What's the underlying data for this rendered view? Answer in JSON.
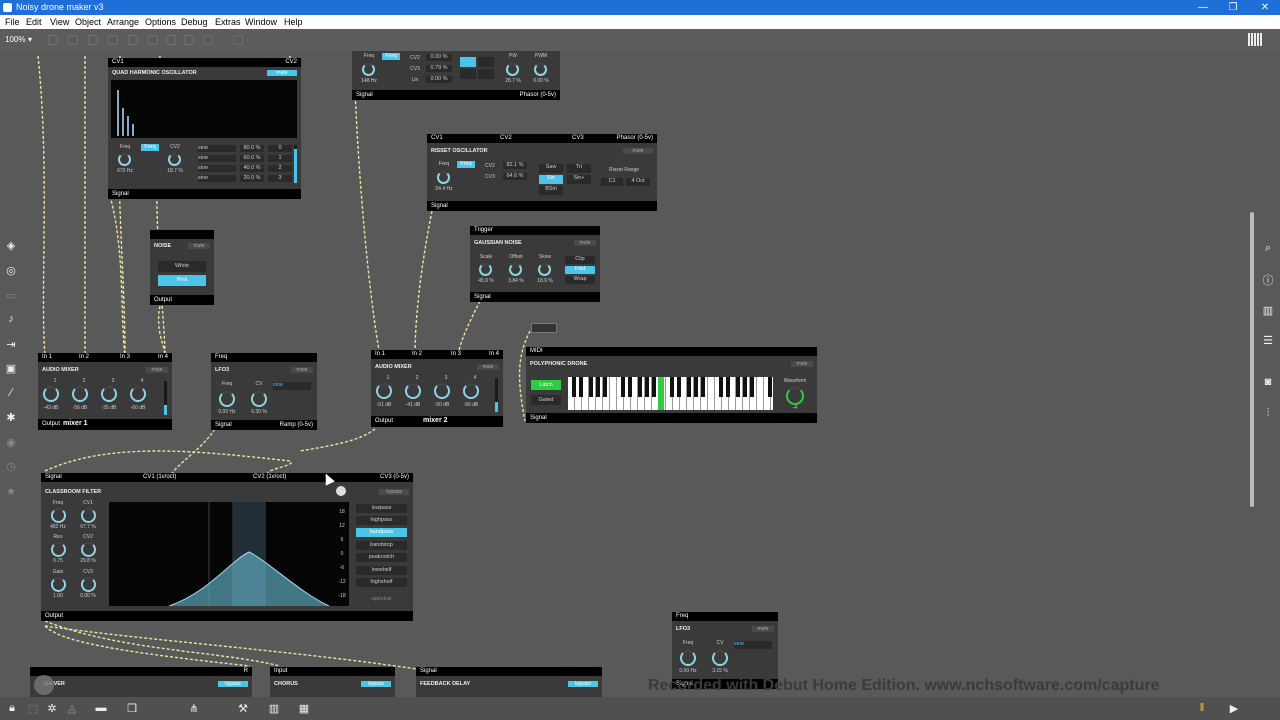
{
  "window": {
    "title": "Noisy drone maker v3",
    "min": "—",
    "max": "❐",
    "close": "✕"
  },
  "menu": [
    "File",
    "Edit",
    "View",
    "Object",
    "Arrange",
    "Options",
    "Debug",
    "Extras",
    "Window",
    "Help"
  ],
  "toolbar": {
    "zoom": "100%"
  },
  "modules": {
    "qho": {
      "cv1": "CV1",
      "cv2": "CV2",
      "title": "QUAD HARMONIC OSCILLATOR",
      "mute": "mute",
      "freq_label": "Freq",
      "freq_btn": "Freq",
      "cv2_label": "CV2",
      "freq_val": "670 Hz",
      "cv2_val": "18.7 %",
      "rows": [
        {
          "wave": "sine",
          "pct": "80.0 %",
          "n": "0"
        },
        {
          "wave": "sine",
          "pct": "60.0 %",
          "n": "1"
        },
        {
          "wave": "sine",
          "pct": "40.0 %",
          "n": "2"
        },
        {
          "wave": "sine",
          "pct": "20.0 %",
          "n": "3"
        }
      ],
      "out": "Signal"
    },
    "top": {
      "freq_label": "Freq",
      "freq_btn": "Freq",
      "freq_val": "148 Hz",
      "cv2": "CV2",
      "cv3": "CV3",
      "lin": "Lin",
      "cv2_v": "0.00 %",
      "cv3_v": "0.79 %",
      "lin_v": "0.00 %",
      "pw": "PW",
      "pwm": "PWM",
      "pw_v": "28.7 %",
      "pwm_v": "0.00 %",
      "out": "Signal",
      "out2": "Phasor (0-5v)"
    },
    "risset": {
      "cv1": "CV1",
      "cv2": "CV2",
      "cv3": "CV3",
      "phasor": "Phasor (0-5v)",
      "title": "RISSET OSCILLATOR",
      "mute": "mute",
      "freq_label": "Freq",
      "freq_btn": "Freq",
      "cv2_label": "CV2",
      "cv2_v": "82.1 %",
      "cv3_label": "CV3",
      "cv3_v": "64.6 %",
      "freq_val": "54.4 Hz",
      "waves": [
        "Saw",
        "Tri",
        "Sin",
        "Sin+",
        "BSin"
      ],
      "range_label": "Risset Range",
      "range_a": "C1",
      "range_b": "4 Oct",
      "out": "Signal"
    },
    "noise": {
      "title": "NOISE",
      "mute": "mute",
      "white": "White",
      "pink": "Pink",
      "out": "Output"
    },
    "gauss": {
      "trigger": "Trigger",
      "title": "GAUSSIAN NOISE",
      "mute": "mute",
      "scale": "Scale",
      "offset": "Offset",
      "skew": "Skew",
      "scale_v": "45.9 %",
      "offset_v": "3.84 %",
      "skew_v": "18.9 %",
      "clip": "Clip",
      "fold": "Fold",
      "wrap": "Wrap",
      "out": "Signal"
    },
    "midiin": "midiin",
    "mixer1": {
      "in": [
        "In 1",
        "In 2",
        "In 3",
        "In 4"
      ],
      "title": "AUDIO MIXER",
      "mute": "mute",
      "nums": [
        "1",
        "2",
        "3",
        "4"
      ],
      "m": "m",
      "vals": [
        "-43 dB",
        "-56 dB",
        "-35 dB",
        "-60 dB"
      ],
      "out": "Output",
      "name": "mixer 1"
    },
    "lfo3a": {
      "freq": "Freq",
      "title": "LFO3",
      "mute": "mute",
      "freq_label": "Freq",
      "cv_label": "CV",
      "wave": "sine",
      "freq_v": "0.00 Hz",
      "cv_v": "6.30 %",
      "out": "Signal",
      "out2": "Ramp (0-5v)"
    },
    "mixer2": {
      "in": [
        "In 1",
        "In 2",
        "In 3",
        "In 4"
      ],
      "title": "AUDIO MIXER",
      "mute": "mute",
      "nums": [
        "1",
        "2",
        "3",
        "4"
      ],
      "m": "m",
      "vals": [
        "-51 dB",
        "-41 dB",
        "-50 dB",
        "-56 dB"
      ],
      "out": "Output",
      "name": "mixer 2"
    },
    "poly": {
      "midi": "MIDI",
      "title": "POLYPHONIC DRONE",
      "mute": "mute",
      "latch": "Latch",
      "gated": "Gated",
      "waveform": "Waveform",
      "wave_v": "-4",
      "out": "Signal"
    },
    "filter": {
      "signal": "Signal",
      "cv1": "CV1 (1v/oct)",
      "cv2": "CV2 (1v/oct)",
      "cv3": "CV3 (0-5v)",
      "title": "CLASSROOM FILTER",
      "bypass": "bypass",
      "freq": "Freq",
      "freq_v": "482 Hz",
      "cv1_l": "CV1",
      "cv1_v": "67.7 %",
      "res": "Res",
      "res_v": "0.75",
      "cv2_l": "CV2",
      "cv2_v": "29.8 %",
      "gain": "Gain",
      "gain_v": "1.00",
      "cv3_l": "CV3",
      "cv3_v": "0.00 %",
      "db": [
        "18",
        "12",
        "6",
        "0",
        "-6",
        "-12",
        "-18"
      ],
      "modes": [
        "lowpass",
        "highpass",
        "bandpass",
        "bandstop",
        "peaknotch",
        "lowshelf",
        "highshelf"
      ],
      "spectral": "spectral",
      "out": "Output"
    },
    "lfo3b": {
      "freq": "Freq",
      "title": "LFO3",
      "mute": "mute",
      "freq_label": "Freq",
      "cv_label": "CV",
      "wave": "sine",
      "freq_v": "0.00 Hz",
      "cv_v": "3.15 %",
      "out": "Signal"
    },
    "bottom": {
      "r": "R",
      "a_title": "GA  VER",
      "a_bypass": "bypass",
      "input": "Input",
      "chorus": "CHORUS",
      "chorus_bypass": "bypass",
      "signal": "Signal",
      "delay": "FEEDBACK DELAY",
      "delay_bypass": "bypass"
    }
  },
  "watermark": "Recorded with Debut Home Edition. www.nchsoftware.com/capture",
  "colors": {
    "accent": "#4cc6e8",
    "green": "#2ecc40",
    "title_bar": "#1e6fd9"
  }
}
